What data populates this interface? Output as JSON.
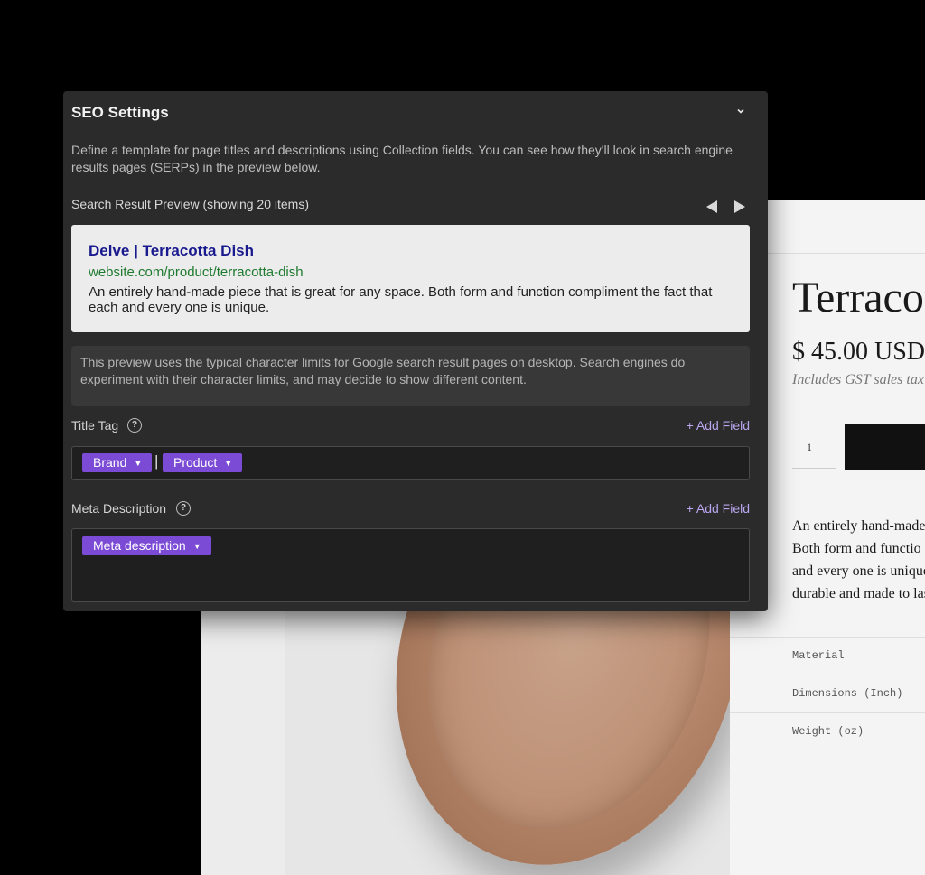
{
  "product_page": {
    "title": "Terracotta",
    "price": "$ 45.00 USD",
    "tax_note": "Includes GST sales tax",
    "quantity": "1",
    "description_lines": [
      "An entirely hand-made",
      "Both form and functio",
      "and every one is unique",
      "durable and made to las"
    ],
    "specs": [
      "Material",
      "Dimensions (Inch)",
      "Weight (oz)"
    ]
  },
  "seo_panel": {
    "title": "SEO Settings",
    "collapse_icon": "chevron-down-icon",
    "description": "Define a template for page titles and descriptions using Collection fields. You can see how they'll look in search engine results pages (SERPs) in the preview below.",
    "preview_label": "Search Result Preview (showing 20 items)",
    "serp": {
      "title": "Delve | Terracotta Dish",
      "url": "website.com/product/terracotta-dish",
      "snippet": "An entirely hand-made piece that is great for any space. Both form and function compliment the fact that each and every one is unique."
    },
    "note": "This preview uses the typical character limits for Google search result pages on desktop. Search engines do experiment with their character limits, and may decide to show different content.",
    "title_tag": {
      "label": "Title Tag",
      "add_field": "+ Add Field",
      "tokens": [
        "Brand",
        "Product"
      ],
      "separator": "|"
    },
    "meta_description": {
      "label": "Meta Description",
      "add_field": "+ Add Field",
      "tokens": [
        "Meta description"
      ]
    },
    "help_icon_glyph": "?",
    "colors": {
      "panel_bg": "#2b2b2b",
      "token_purple": "#7b4bd6",
      "link_blue": "#1a1a8f",
      "url_green": "#1e7a2e",
      "accent_lavender": "#b9a6ee"
    }
  }
}
